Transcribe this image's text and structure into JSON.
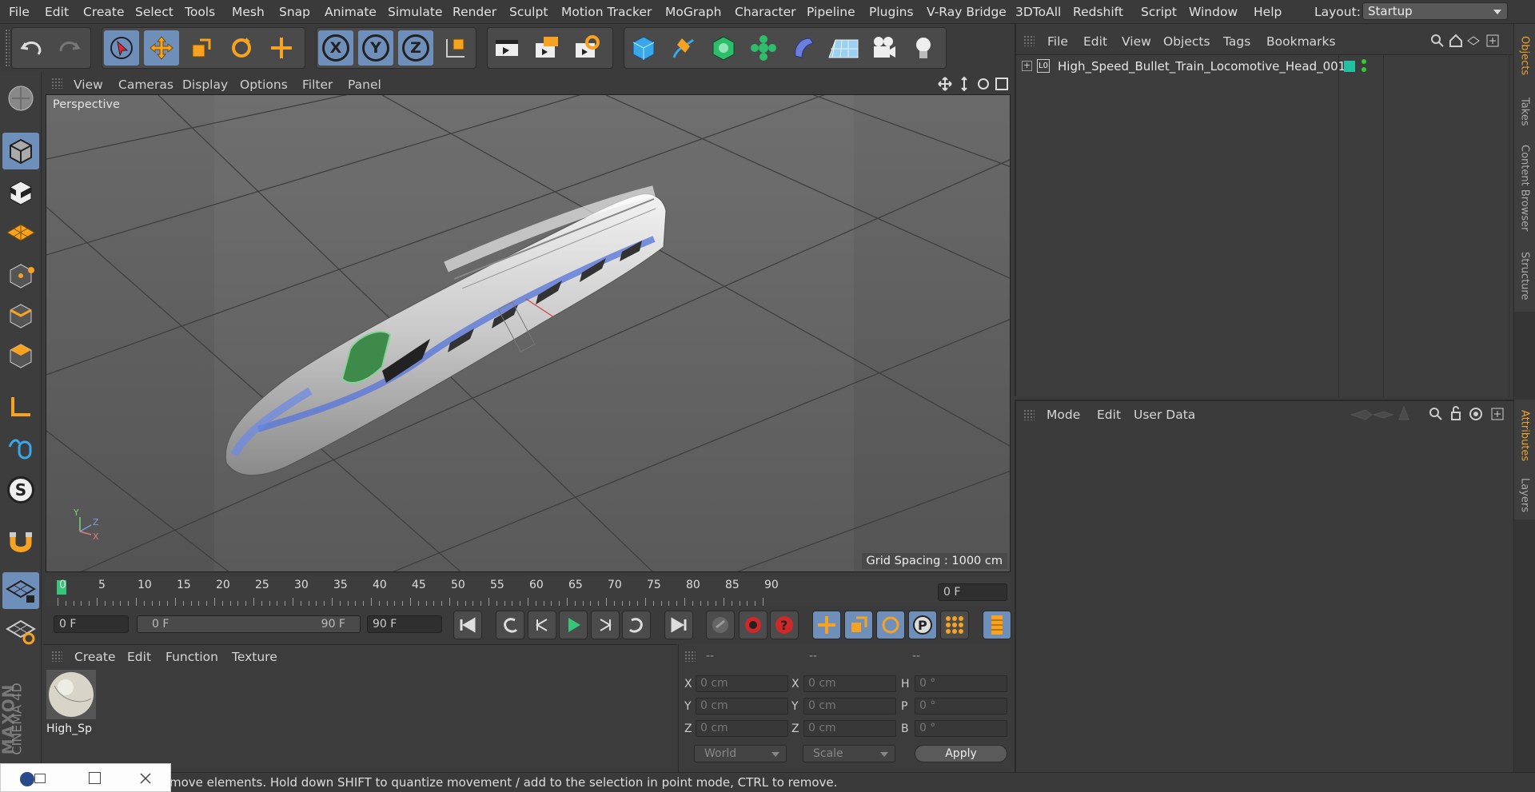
{
  "menu": [
    "File",
    "Edit",
    "Create",
    "Select",
    "Tools",
    "Mesh",
    "Snap",
    "Animate",
    "Simulate",
    "Render",
    "Sculpt",
    "Motion Tracker",
    "MoGraph",
    "Character",
    "Pipeline",
    "Plugins",
    "V-Ray Bridge",
    "3DToAll",
    "Redshift",
    "Script",
    "Window",
    "Help"
  ],
  "layout": {
    "label": "Layout:",
    "value": "Startup"
  },
  "toolbar": {
    "x": "X",
    "y": "Y",
    "z": "Z"
  },
  "viewport": {
    "menu": [
      "View",
      "Cameras",
      "Display",
      "Options",
      "Filter",
      "Panel"
    ],
    "label": "Perspective",
    "grid_spacing": "Grid Spacing : 1000 cm",
    "axis": {
      "y": "Y",
      "z": "Z",
      "x": "X"
    }
  },
  "objects_panel": {
    "menu": [
      "File",
      "Edit",
      "View",
      "Objects",
      "Tags",
      "Bookmarks"
    ],
    "object_name": "High_Speed_Bullet_Train_Locomotive_Head_001",
    "layer_icon": "L0",
    "tag_color": "#20c0a0"
  },
  "attributes_panel": {
    "menu": [
      "Mode",
      "Edit",
      "User Data"
    ]
  },
  "right_tabs": [
    "Objects",
    "Takes",
    "Content Browser",
    "Structure"
  ],
  "right_tabs2": [
    "Attributes",
    "Layers"
  ],
  "timeline": {
    "ticks": [
      "0",
      "5",
      "10",
      "15",
      "20",
      "25",
      "30",
      "35",
      "40",
      "45",
      "50",
      "55",
      "60",
      "65",
      "70",
      "75",
      "80",
      "85",
      "90"
    ],
    "current_frame": "0 F"
  },
  "playback": {
    "start": "0 F",
    "range_start": "0 F",
    "range_end": "90 F",
    "end": "90 F"
  },
  "material_panel": {
    "menu": [
      "Create",
      "Edit",
      "Function",
      "Texture"
    ],
    "material_name": "High_Sp"
  },
  "coords": {
    "headers": [
      "--",
      "--",
      "--"
    ],
    "rows": [
      {
        "l1": "X",
        "v1": "0 cm",
        "l2": "X",
        "v2": "0 cm",
        "l3": "H",
        "v3": "0 °"
      },
      {
        "l1": "Y",
        "v1": "0 cm",
        "l2": "Y",
        "v2": "0 cm",
        "l3": "P",
        "v3": "0 °"
      },
      {
        "l1": "Z",
        "v1": "0 cm",
        "l2": "Z",
        "v2": "0 cm",
        "l3": "B",
        "v3": "0 °"
      }
    ],
    "world": "World",
    "scale": "Scale",
    "apply": "Apply"
  },
  "brand": {
    "line1": "MAXON",
    "line2": "CINEMA 4D"
  },
  "status": "move elements. Hold down SHIFT to quantize movement / add to the selection in point mode, CTRL to remove.",
  "accent": "#6f8fbb"
}
